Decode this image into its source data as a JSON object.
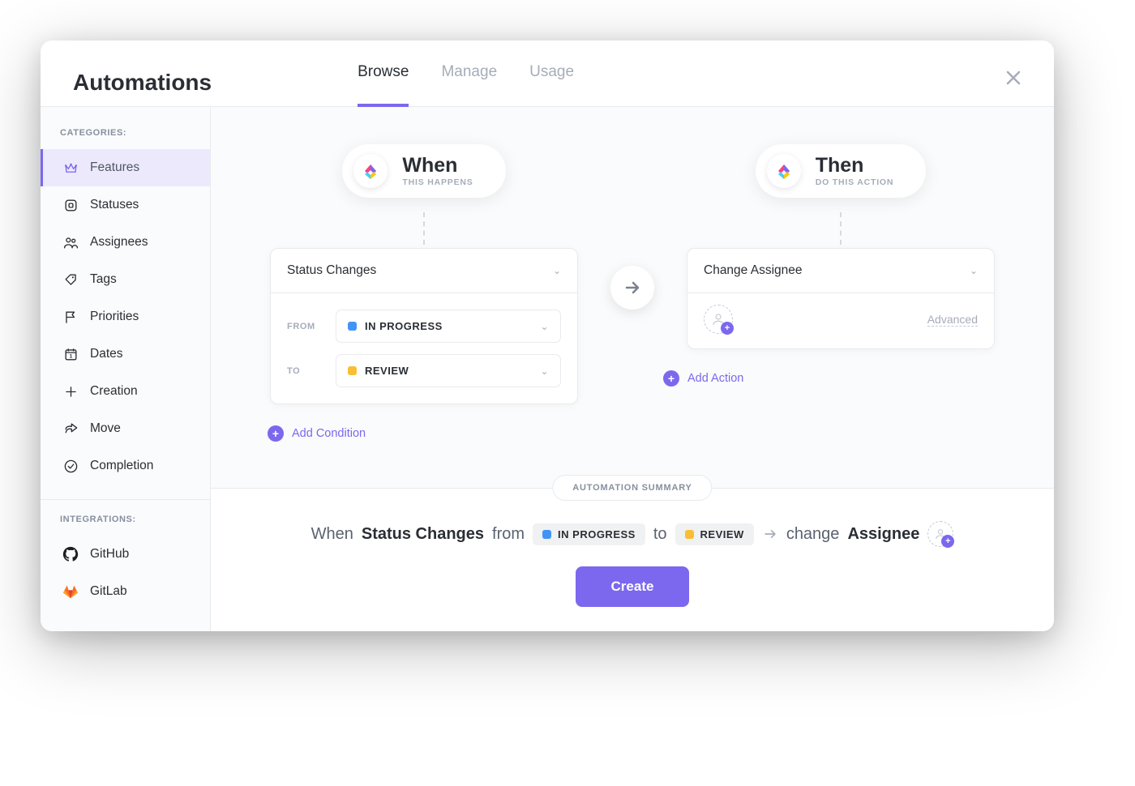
{
  "header": {
    "title": "Automations",
    "tabs": [
      {
        "label": "Browse",
        "active": true
      },
      {
        "label": "Manage",
        "active": false
      },
      {
        "label": "Usage",
        "active": false
      }
    ]
  },
  "sidebar": {
    "categories_label": "CATEGORIES:",
    "integrations_label": "INTEGRATIONS:",
    "categories": [
      {
        "label": "Features",
        "icon": "crown-icon",
        "active": true
      },
      {
        "label": "Statuses",
        "icon": "square-icon",
        "active": false
      },
      {
        "label": "Assignees",
        "icon": "people-icon",
        "active": false
      },
      {
        "label": "Tags",
        "icon": "tag-icon",
        "active": false
      },
      {
        "label": "Priorities",
        "icon": "flag-icon",
        "active": false
      },
      {
        "label": "Dates",
        "icon": "calendar-icon",
        "active": false
      },
      {
        "label": "Creation",
        "icon": "plus-icon",
        "active": false
      },
      {
        "label": "Move",
        "icon": "share-icon",
        "active": false
      },
      {
        "label": "Completion",
        "icon": "check-circle-icon",
        "active": false
      }
    ],
    "integrations": [
      {
        "label": "GitHub",
        "icon": "github-icon"
      },
      {
        "label": "GitLab",
        "icon": "gitlab-icon"
      }
    ]
  },
  "builder": {
    "when": {
      "title": "When",
      "sub": "THIS HAPPENS",
      "trigger": "Status Changes",
      "from_label": "FROM",
      "from_value": "IN PROGRESS",
      "from_color": "#4194f6",
      "to_label": "TO",
      "to_value": "REVIEW",
      "to_color": "#f9be33",
      "add_condition": "Add Condition"
    },
    "then": {
      "title": "Then",
      "sub": "DO THIS ACTION",
      "action": "Change Assignee",
      "advanced": "Advanced",
      "add_action": "Add Action"
    }
  },
  "summary": {
    "badge": "AUTOMATION SUMMARY",
    "when_word": "When",
    "trigger_bold": "Status Changes",
    "from_word": "from",
    "from_chip": "IN PROGRESS",
    "from_color": "#4194f6",
    "to_word": "to",
    "to_chip": "REVIEW",
    "to_color": "#f9be33",
    "change_word": "change",
    "assignee_bold": "Assignee",
    "create_label": "Create"
  }
}
